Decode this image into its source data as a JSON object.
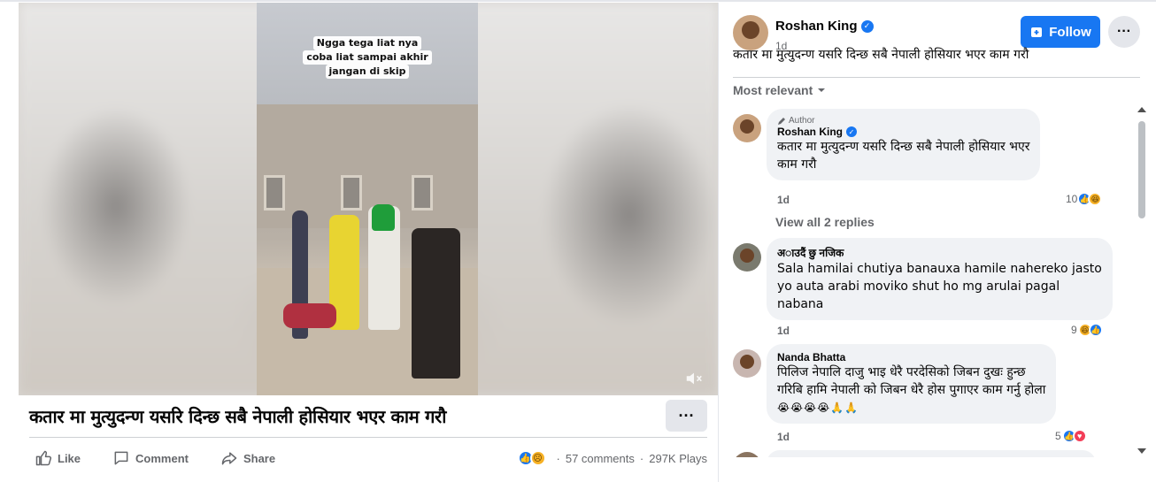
{
  "video": {
    "overlay_text": [
      "Ngga tega liat nya",
      "coba liat sampai akhir",
      "jangan di skip"
    ],
    "mute_icon": "speaker-muted-icon"
  },
  "post": {
    "title": "कतार मा मुत्युदन्ण यसरि दिन्छ सबै नेपाली होसियार भएर काम गरौ",
    "more_label": "···",
    "actions": {
      "like": "Like",
      "comment": "Comment",
      "share": "Share"
    },
    "stats": {
      "comments": "57 comments",
      "separator": "·",
      "plays": "297K Plays"
    }
  },
  "sidebar": {
    "author": "Roshan King",
    "time": "1d",
    "follow_label": "Follow",
    "more_label": "···",
    "description": "कतार मा मुत्युदन्ण यसरि दिन्छ सबै नेपाली होसियार भएर काम गरौ",
    "sort_label": "Most relevant"
  },
  "comments": [
    {
      "tag": "Author",
      "name": "Roshan King",
      "verified": true,
      "lines": [
        "कतार मा मुत्युदन्ण यसरि दिन्छ सबै नेपाली होसियार भएर",
        "काम गरौ"
      ],
      "time": "1d",
      "reaction_count": "10",
      "view_replies": "View all 2 replies"
    },
    {
      "name": "अाउदैं छु नजिक",
      "lines": [
        "Sala hamilai chutiya banauxa hamile nahereko jasto",
        "yo auta arabi moviko shut ho mg arulai pagal",
        "nabana"
      ],
      "time": "1d",
      "reaction_count": "9"
    },
    {
      "name": "Nanda Bhatta",
      "lines": [
        "पिलिज नेपालि दाजु भाइ धेरै परदेसिको जिबन दुखः हुन्छ",
        "गरिबि हामि नेपाली को जिबन धेरै होस पुगाएर काम गर्नु होला"
      ],
      "emojis": "😭😭😭😭🙏🙏",
      "time": "1d",
      "reaction_count": "5"
    }
  ],
  "colors": {
    "accent": "#1877f2",
    "muted_text": "#65676b",
    "bubble": "#f0f2f5"
  }
}
